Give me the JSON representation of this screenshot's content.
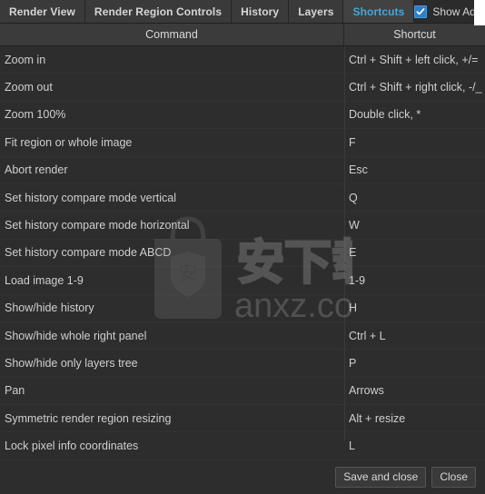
{
  "window": {
    "accent_color": "#3fa9e0",
    "background_color": "#2d2d2d"
  },
  "tabs": [
    {
      "label": "Render View",
      "active": false
    },
    {
      "label": "Render Region Controls",
      "active": false
    },
    {
      "label": "History",
      "active": false
    },
    {
      "label": "Layers",
      "active": false
    },
    {
      "label": "Shortcuts",
      "active": true
    }
  ],
  "advanced_settings": {
    "label": "Show Advanced Settin",
    "checked": true
  },
  "table": {
    "headers": {
      "command": "Command",
      "shortcut": "Shortcut"
    },
    "rows": [
      {
        "command": "Zoom in",
        "shortcut": "Ctrl + Shift + left click, +/="
      },
      {
        "command": "Zoom out",
        "shortcut": "Ctrl + Shift + right click, -/_"
      },
      {
        "command": "Zoom 100%",
        "shortcut": "Double click, *"
      },
      {
        "command": "Fit region or whole image",
        "shortcut": "F"
      },
      {
        "command": "Abort render",
        "shortcut": "Esc"
      },
      {
        "command": "Set history compare mode vertical",
        "shortcut": "Q"
      },
      {
        "command": "Set history compare mode horizontal",
        "shortcut": "W"
      },
      {
        "command": "Set history compare mode ABCD",
        "shortcut": "E"
      },
      {
        "command": "Load image 1-9",
        "shortcut": "1-9"
      },
      {
        "command": "Show/hide history",
        "shortcut": "H"
      },
      {
        "command": "Show/hide whole right panel",
        "shortcut": "Ctrl + L"
      },
      {
        "command": "Show/hide only layers tree",
        "shortcut": "P"
      },
      {
        "command": "Pan",
        "shortcut": "Arrows"
      },
      {
        "command": "Symmetric render region resizing",
        "shortcut": "Alt + resize"
      },
      {
        "command": "Lock pixel info coordinates",
        "shortcut": "L"
      }
    ]
  },
  "watermark": {
    "text_cn": "安下载",
    "text_domain": "anxz.com"
  },
  "footer": {
    "save_and_close_label": "Save and close",
    "close_label": "Close"
  }
}
